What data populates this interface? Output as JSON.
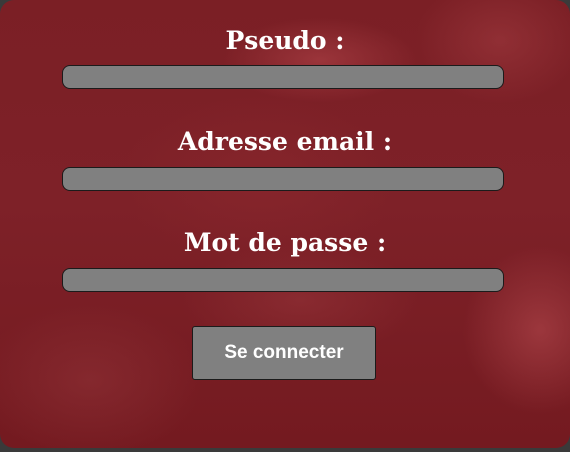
{
  "form": {
    "username_label": "Pseudo :",
    "email_label": "Adresse email :",
    "password_label": "Mot de passe :",
    "username_value": "",
    "email_value": "",
    "password_value": "",
    "submit_label": "Se connecter"
  },
  "colors": {
    "background": "#7b1f25",
    "field": "#808080",
    "button": "#808080",
    "text": "#ffffff"
  }
}
